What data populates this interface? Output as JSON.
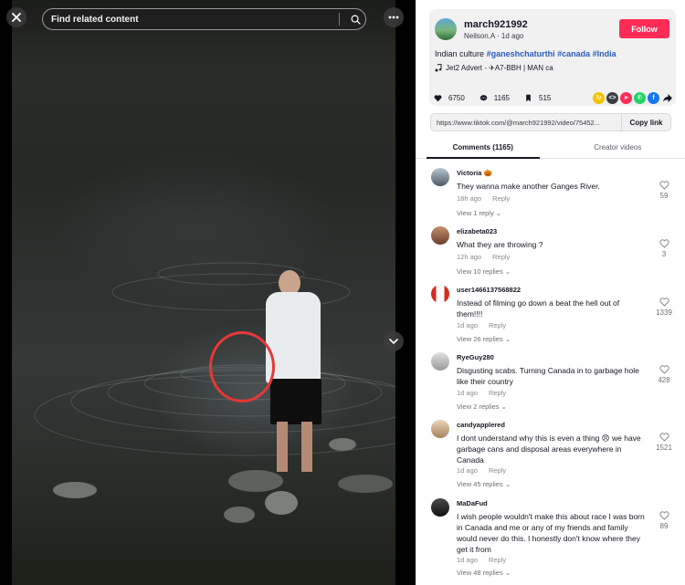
{
  "video": {
    "search_placeholder": "Find related content"
  },
  "author": {
    "username": "march921992",
    "subline": "Neilson.A · 1d ago",
    "follow_label": "Follow",
    "caption_text": "Indian culture",
    "caption_tags": "#ganeshchaturthi #canada #India",
    "music": "Jet2 Advert - ✈A7-BBH | MAN ca"
  },
  "stats": {
    "likes": "6750",
    "comments": "1165",
    "saves": "515"
  },
  "link": {
    "url": "https://www.tiktok.com/@march921992/video/75452...",
    "copy_label": "Copy link"
  },
  "tabs": {
    "comments_label": "Comments (1165)",
    "creator_label": "Creator videos"
  },
  "comments": [
    {
      "user": "Victoria 🎃",
      "text": "They wanna make another Ganges River.",
      "time": "18h ago",
      "reply": "Reply",
      "replies": "View 1 reply",
      "likes": "59"
    },
    {
      "user": "elizabeta023",
      "text": "What they are throwing ?",
      "time": "12h ago",
      "reply": "Reply",
      "replies": "View 10 replies",
      "likes": "3"
    },
    {
      "user": "user1466137568822",
      "text": "Instead of filming go down a beat the hell out of them!!!!",
      "time": "1d ago",
      "reply": "Reply",
      "replies": "View 26 replies",
      "likes": "1339"
    },
    {
      "user": "RyeGuy280",
      "text": "Disgusting scabs. Turning Canada in to garbage hole like their country",
      "time": "1d ago",
      "reply": "Reply",
      "replies": "View 2 replies",
      "likes": "428"
    },
    {
      "user": "candyapplered",
      "text": "I dont understand why this is even a thing 😠 we have garbage cans and disposal areas everywhere in Canada",
      "time": "1d ago",
      "reply": "Reply",
      "replies": "View 45 replies",
      "likes": "1521"
    },
    {
      "user": "MaDaFud",
      "text": "I wish people wouldn't make this about race I was born in Canada and me or any of my friends and family would never do this. I honestly don't know where they get it from",
      "time": "1d ago",
      "reply": "Reply",
      "replies": "View 48 replies",
      "likes": "89"
    }
  ],
  "colors": {
    "follow": "#fe2c55",
    "tag": "#2b5db9"
  }
}
